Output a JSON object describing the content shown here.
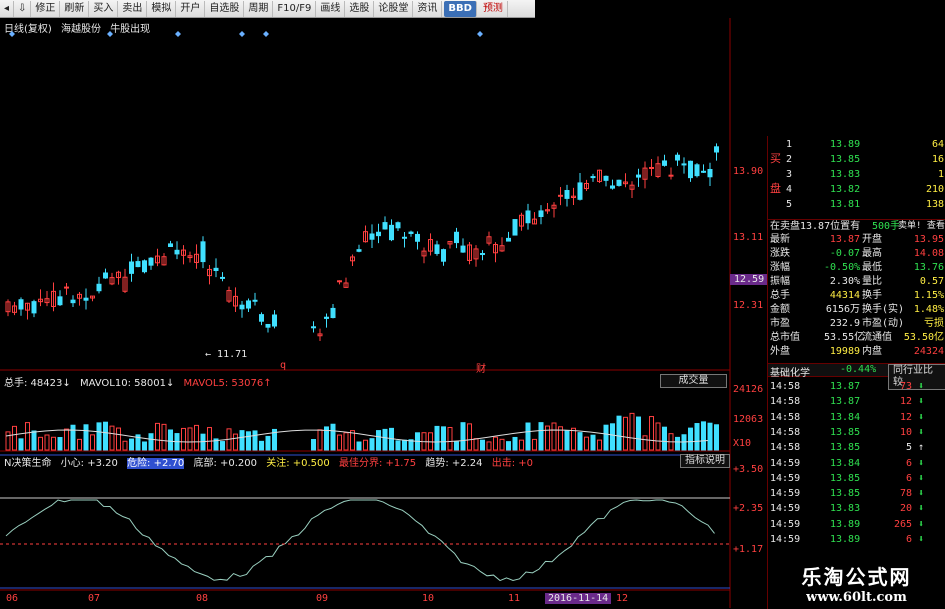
{
  "toolbar": {
    "items": [
      "修正",
      "刷新",
      "买入",
      "卖出",
      "模拟",
      "开户",
      "自选股",
      "周期",
      "F10/F9",
      "画线",
      "选股",
      "论股堂",
      "资讯",
      "BBD",
      "预测"
    ]
  },
  "chart_header": {
    "period": "日线(复权)",
    "stock": "海越股份",
    "signal": "牛股出现"
  },
  "price_axis": [
    "13.90",
    "13.11",
    "12.59",
    "12.31"
  ],
  "low_marker": "11.71",
  "marks": [
    "q",
    "财"
  ],
  "volume": {
    "total_label": "总手: 48423↓",
    "mavol10": "MAVOL10: 58001↓",
    "mavol5": "MAVOL5: 53076↑",
    "button": "成交量",
    "axis": [
      "24126",
      "12063",
      "X10"
    ]
  },
  "indicator": {
    "name": "N决策生命",
    "params": [
      "小心: +3.20",
      "危险: +2.70",
      "底部: +0.200",
      "关注: +0.500",
      "最佳分界: +1.75",
      "趋势: +2.24",
      "出击: +0"
    ],
    "button": "指标说明",
    "axis": [
      "+3.50",
      "+2.35",
      "+1.17"
    ]
  },
  "dates": [
    "06",
    "07",
    "08",
    "09",
    "10",
    "11",
    "2016-11-14",
    "12"
  ],
  "quote": {
    "bid_side_label": "买",
    "bid_side_label2": "盘",
    "bids": [
      {
        "level": "1",
        "price": "13.89",
        "vol": "64"
      },
      {
        "level": "2",
        "price": "13.85",
        "vol": "16"
      },
      {
        "level": "3",
        "price": "13.83",
        "vol": "1"
      },
      {
        "level": "4",
        "price": "13.82",
        "vol": "210"
      },
      {
        "level": "5",
        "price": "13.81",
        "vol": "138"
      }
    ],
    "order_line": "在卖盘13.87位置有",
    "order_vol": "500手",
    "order_link": "卖单! 查看详细",
    "stats": [
      [
        "最新",
        "13.87",
        "开盘",
        "13.95"
      ],
      [
        "涨跌",
        "-0.07",
        "最高",
        "14.08"
      ],
      [
        "涨幅",
        "-0.50%",
        "最低",
        "13.76"
      ],
      [
        "振幅",
        "2.30%",
        "量比",
        "0.57"
      ],
      [
        "总手",
        "44314",
        "换手",
        "1.15%"
      ],
      [
        "金额",
        "6156万",
        "换手(实)",
        "1.48%"
      ],
      [
        "市盈",
        "232.9",
        "市盈(动)",
        "亏损"
      ],
      [
        "总市值",
        "53.55亿",
        "流通值",
        "53.50亿"
      ],
      [
        "外盘",
        "19989",
        "内盘",
        "24324"
      ]
    ],
    "sector": "基础化学",
    "sector_change": "-0.44%",
    "sector_btn": "同行业比较",
    "ticks": [
      [
        "14:58",
        "13.87",
        "73",
        "down"
      ],
      [
        "14:58",
        "13.87",
        "12",
        "down"
      ],
      [
        "14:58",
        "13.84",
        "12",
        "down"
      ],
      [
        "14:58",
        "13.85",
        "10",
        "down"
      ],
      [
        "14:58",
        "13.85",
        "5",
        "up"
      ],
      [
        "14:59",
        "13.84",
        "6",
        "down"
      ],
      [
        "14:59",
        "13.85",
        "6",
        "down"
      ],
      [
        "14:59",
        "13.85",
        "78",
        "down"
      ],
      [
        "14:59",
        "13.83",
        "20",
        "down"
      ],
      [
        "14:59",
        "13.89",
        "265",
        "down"
      ],
      [
        "14:59",
        "13.89",
        "6",
        "down"
      ]
    ]
  },
  "watermark": {
    "line1": "乐淘公式网",
    "line2": "www.60lt.com"
  },
  "colors": {
    "up": "#ff4040",
    "down": "#40e0ff",
    "grid_red": "#8b0000"
  }
}
